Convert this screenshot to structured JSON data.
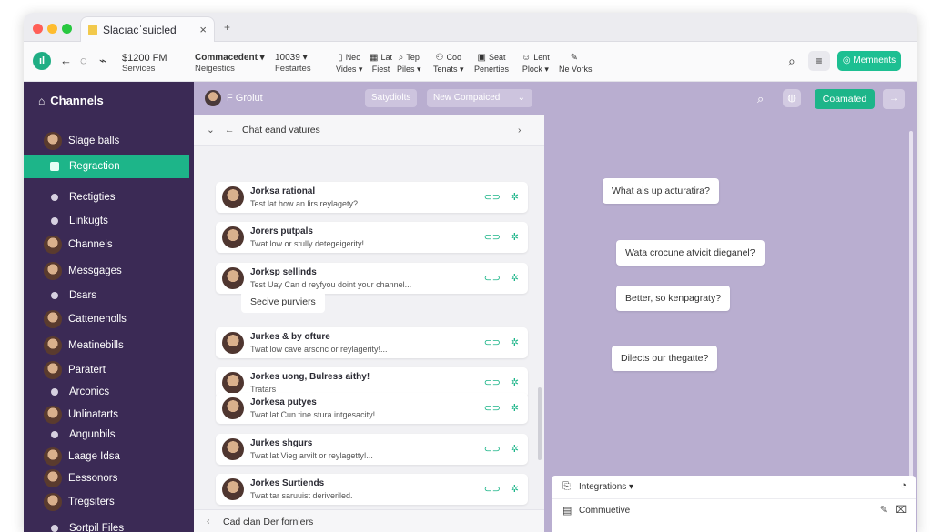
{
  "browser": {
    "tab_title": "Slacıacˈsuicled",
    "tab_close": "×",
    "new_tab": "+"
  },
  "colors": {
    "accent": "#1db589",
    "sidebar_bg": "#3b2a55",
    "pane_bg": "#b9aed0"
  },
  "toolbar": {
    "stats": {
      "l1": "$1200 FM",
      "l2": "Services"
    },
    "combo": {
      "l1": "Commacedent ▾",
      "l2": "Neigestics"
    },
    "count": {
      "l1": "10039 ▾",
      "l2": "Festartes"
    },
    "tools": [
      {
        "l1": "Neo",
        "l2": "Vides ▾",
        "icon": "document-icon"
      },
      {
        "l1": "Lat",
        "l2": "Fiest",
        "icon": "calendar-icon"
      },
      {
        "l1": "Tep",
        "l2": "Piles ▾",
        "icon": "search-icon"
      },
      {
        "l1": "Coo",
        "l2": "Tenats ▾",
        "icon": "people-icon"
      },
      {
        "l1": "Seat",
        "l2": "Penerties",
        "icon": "image-icon"
      },
      {
        "l1": "Lent",
        "l2": "Plock ▾",
        "icon": "user-icon"
      },
      {
        "l1": "",
        "l2": "Ne Vorks",
        "icon": "pen-icon"
      }
    ],
    "members_label": "Memnents"
  },
  "sidebar": {
    "header": "Channels",
    "items": [
      {
        "label": "Slage balls",
        "kind": "avatar"
      },
      {
        "label": "Regraction",
        "kind": "square",
        "active": true
      },
      {
        "label": "Rectigties",
        "kind": "dot"
      },
      {
        "label": "Linkugts",
        "kind": "dot"
      },
      {
        "label": "Channels",
        "kind": "avatar"
      },
      {
        "label": "Messgages",
        "kind": "avatar"
      },
      {
        "label": "Dsars",
        "kind": "dot"
      },
      {
        "label": "Cattenenolls",
        "kind": "avatar"
      },
      {
        "label": "Meatinebills",
        "kind": "avatar"
      },
      {
        "label": "Paratert",
        "kind": "avatar"
      },
      {
        "label": "Arconics",
        "kind": "dot"
      },
      {
        "label": "Unlinatarts",
        "kind": "avatar"
      },
      {
        "label": "Angunbils",
        "kind": "dot"
      },
      {
        "label": "Laage Idsa",
        "kind": "avatar"
      },
      {
        "label": "Eessonors",
        "kind": "avatar"
      },
      {
        "label": "Tregsiters",
        "kind": "avatar"
      },
      {
        "label": "Sortpil Files",
        "kind": "dot"
      }
    ]
  },
  "middle": {
    "header_title": "F Groiut",
    "pill1": "Satydiolts",
    "pill2": "New Compaiced",
    "list_header": "Chat eand vatures",
    "section_label": "Secive purviers",
    "footer": "Cad clan Der forniers",
    "cards": [
      {
        "name": "Jorksa rational",
        "preview": "Test lat how an lirs reylagety?"
      },
      {
        "name": "Jorers putpals",
        "preview": "Twat low or stully detegeigerity!..."
      },
      {
        "name": "Jorksp sellinds",
        "preview": "Test Uay Can d reyfyou doint your channel..."
      },
      {
        "name": "Jurkes & by ofture",
        "preview": "Twat low cave arsonc or reylagerity!..."
      },
      {
        "name": "Jorkes uong, Bulress aithy!",
        "preview": "Tratars"
      },
      {
        "name": "Jorkesa putyes",
        "preview": "Twat lat Cun tine stura intgesacity!..."
      },
      {
        "name": "Jurkes shgurs",
        "preview": "Twat lat Vieg arvilt or reylagetty!..."
      },
      {
        "name": "Jorkes Surtiends",
        "preview": "Twat tar saruuist deriveriled."
      }
    ]
  },
  "right": {
    "button": "Coamated",
    "arrow": "→",
    "bubbles": [
      "What als up acturatira?",
      "Wata crocune atvicit dieganel?",
      "Better, so kenpagraty?",
      "Dilects our thegatte?"
    ],
    "panel": {
      "row1": "Integrations ▾",
      "row2": "Commuetive"
    }
  }
}
